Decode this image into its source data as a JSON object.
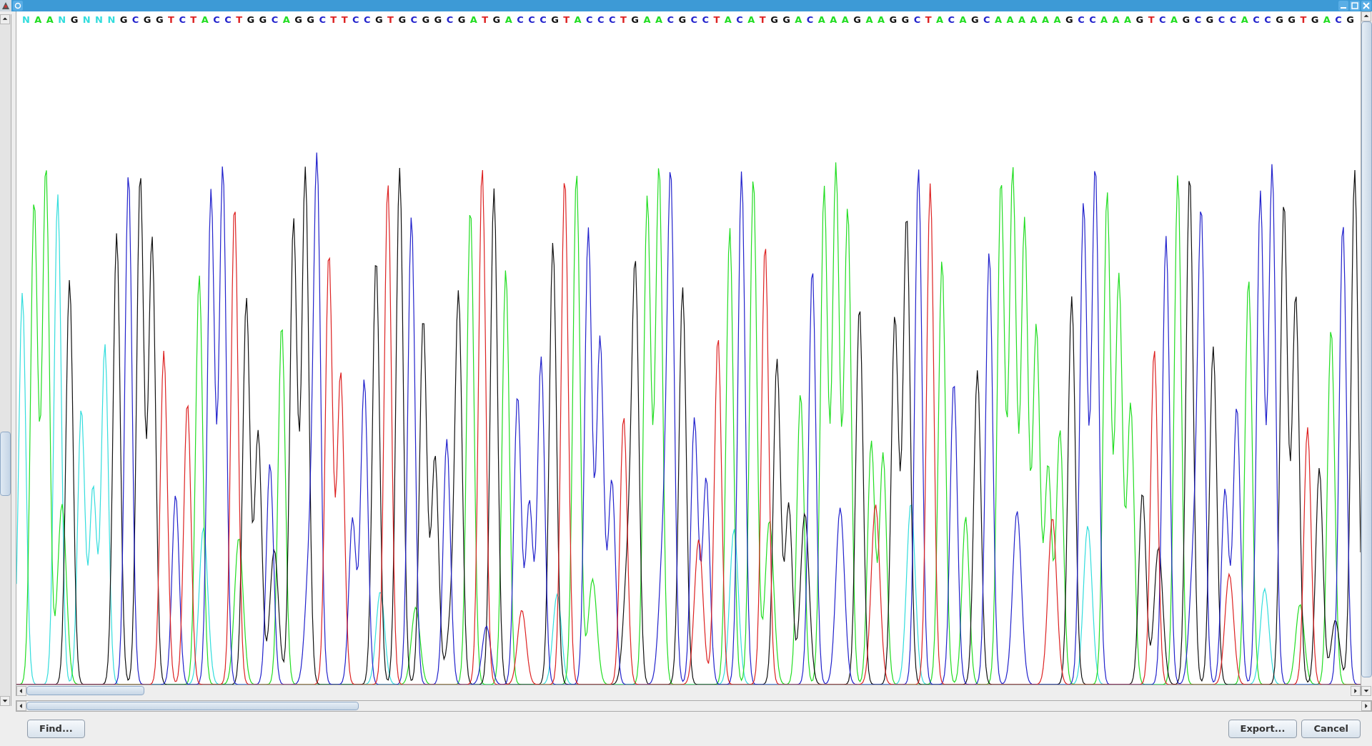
{
  "sequence": [
    {
      "base": "N",
      "color": "#33dddd"
    },
    {
      "base": "A",
      "color": "#22dd22"
    },
    {
      "base": "A",
      "color": "#22dd22"
    },
    {
      "base": "N",
      "color": "#33dddd"
    },
    {
      "base": "G",
      "color": "#111111"
    },
    {
      "base": "N",
      "color": "#33dddd"
    },
    {
      "base": "N",
      "color": "#33dddd"
    },
    {
      "base": "N",
      "color": "#33dddd"
    },
    {
      "base": "G",
      "color": "#111111"
    },
    {
      "base": "C",
      "color": "#2222cc"
    },
    {
      "base": "G",
      "color": "#111111"
    },
    {
      "base": "G",
      "color": "#111111"
    },
    {
      "base": "T",
      "color": "#dd2222"
    },
    {
      "base": "C",
      "color": "#2222cc"
    },
    {
      "base": "T",
      "color": "#dd2222"
    },
    {
      "base": "A",
      "color": "#22dd22"
    },
    {
      "base": "C",
      "color": "#2222cc"
    },
    {
      "base": "C",
      "color": "#2222cc"
    },
    {
      "base": "T",
      "color": "#dd2222"
    },
    {
      "base": "G",
      "color": "#111111"
    },
    {
      "base": "G",
      "color": "#111111"
    },
    {
      "base": "C",
      "color": "#2222cc"
    },
    {
      "base": "A",
      "color": "#22dd22"
    },
    {
      "base": "G",
      "color": "#111111"
    },
    {
      "base": "G",
      "color": "#111111"
    },
    {
      "base": "C",
      "color": "#2222cc"
    },
    {
      "base": "T",
      "color": "#dd2222"
    },
    {
      "base": "T",
      "color": "#dd2222"
    },
    {
      "base": "C",
      "color": "#2222cc"
    },
    {
      "base": "C",
      "color": "#2222cc"
    },
    {
      "base": "G",
      "color": "#111111"
    },
    {
      "base": "T",
      "color": "#dd2222"
    },
    {
      "base": "G",
      "color": "#111111"
    },
    {
      "base": "C",
      "color": "#2222cc"
    },
    {
      "base": "G",
      "color": "#111111"
    },
    {
      "base": "G",
      "color": "#111111"
    },
    {
      "base": "C",
      "color": "#2222cc"
    },
    {
      "base": "G",
      "color": "#111111"
    },
    {
      "base": "A",
      "color": "#22dd22"
    },
    {
      "base": "T",
      "color": "#dd2222"
    },
    {
      "base": "G",
      "color": "#111111"
    },
    {
      "base": "A",
      "color": "#22dd22"
    },
    {
      "base": "C",
      "color": "#2222cc"
    },
    {
      "base": "C",
      "color": "#2222cc"
    },
    {
      "base": "C",
      "color": "#2222cc"
    },
    {
      "base": "G",
      "color": "#111111"
    },
    {
      "base": "T",
      "color": "#dd2222"
    },
    {
      "base": "A",
      "color": "#22dd22"
    },
    {
      "base": "C",
      "color": "#2222cc"
    },
    {
      "base": "C",
      "color": "#2222cc"
    },
    {
      "base": "C",
      "color": "#2222cc"
    },
    {
      "base": "T",
      "color": "#dd2222"
    },
    {
      "base": "G",
      "color": "#111111"
    },
    {
      "base": "A",
      "color": "#22dd22"
    },
    {
      "base": "A",
      "color": "#22dd22"
    },
    {
      "base": "C",
      "color": "#2222cc"
    },
    {
      "base": "G",
      "color": "#111111"
    },
    {
      "base": "C",
      "color": "#2222cc"
    },
    {
      "base": "C",
      "color": "#2222cc"
    },
    {
      "base": "T",
      "color": "#dd2222"
    },
    {
      "base": "A",
      "color": "#22dd22"
    },
    {
      "base": "C",
      "color": "#2222cc"
    },
    {
      "base": "A",
      "color": "#22dd22"
    },
    {
      "base": "T",
      "color": "#dd2222"
    },
    {
      "base": "G",
      "color": "#111111"
    },
    {
      "base": "G",
      "color": "#111111"
    },
    {
      "base": "A",
      "color": "#22dd22"
    },
    {
      "base": "C",
      "color": "#2222cc"
    },
    {
      "base": "A",
      "color": "#22dd22"
    },
    {
      "base": "A",
      "color": "#22dd22"
    },
    {
      "base": "A",
      "color": "#22dd22"
    },
    {
      "base": "G",
      "color": "#111111"
    },
    {
      "base": "A",
      "color": "#22dd22"
    },
    {
      "base": "A",
      "color": "#22dd22"
    },
    {
      "base": "G",
      "color": "#111111"
    },
    {
      "base": "G",
      "color": "#111111"
    },
    {
      "base": "C",
      "color": "#2222cc"
    },
    {
      "base": "T",
      "color": "#dd2222"
    },
    {
      "base": "A",
      "color": "#22dd22"
    },
    {
      "base": "C",
      "color": "#2222cc"
    },
    {
      "base": "A",
      "color": "#22dd22"
    },
    {
      "base": "G",
      "color": "#111111"
    },
    {
      "base": "C",
      "color": "#2222cc"
    },
    {
      "base": "A",
      "color": "#22dd22"
    },
    {
      "base": "A",
      "color": "#22dd22"
    },
    {
      "base": "A",
      "color": "#22dd22"
    },
    {
      "base": "A",
      "color": "#22dd22"
    },
    {
      "base": "A",
      "color": "#22dd22"
    },
    {
      "base": "A",
      "color": "#22dd22"
    },
    {
      "base": "G",
      "color": "#111111"
    },
    {
      "base": "C",
      "color": "#2222cc"
    },
    {
      "base": "C",
      "color": "#2222cc"
    },
    {
      "base": "A",
      "color": "#22dd22"
    },
    {
      "base": "A",
      "color": "#22dd22"
    },
    {
      "base": "A",
      "color": "#22dd22"
    },
    {
      "base": "G",
      "color": "#111111"
    },
    {
      "base": "T",
      "color": "#dd2222"
    },
    {
      "base": "C",
      "color": "#2222cc"
    },
    {
      "base": "A",
      "color": "#22dd22"
    },
    {
      "base": "G",
      "color": "#111111"
    },
    {
      "base": "C",
      "color": "#2222cc"
    },
    {
      "base": "G",
      "color": "#111111"
    },
    {
      "base": "C",
      "color": "#2222cc"
    },
    {
      "base": "C",
      "color": "#2222cc"
    },
    {
      "base": "A",
      "color": "#22dd22"
    },
    {
      "base": "C",
      "color": "#2222cc"
    },
    {
      "base": "C",
      "color": "#2222cc"
    },
    {
      "base": "G",
      "color": "#111111"
    },
    {
      "base": "G",
      "color": "#111111"
    },
    {
      "base": "T",
      "color": "#dd2222"
    },
    {
      "base": "G",
      "color": "#111111"
    },
    {
      "base": "A",
      "color": "#22dd22"
    },
    {
      "base": "C",
      "color": "#2222cc"
    },
    {
      "base": "G",
      "color": "#111111"
    }
  ],
  "buttons_left": [
    "Find..."
  ],
  "buttons_right": [
    "Export...",
    "Cancel"
  ]
}
